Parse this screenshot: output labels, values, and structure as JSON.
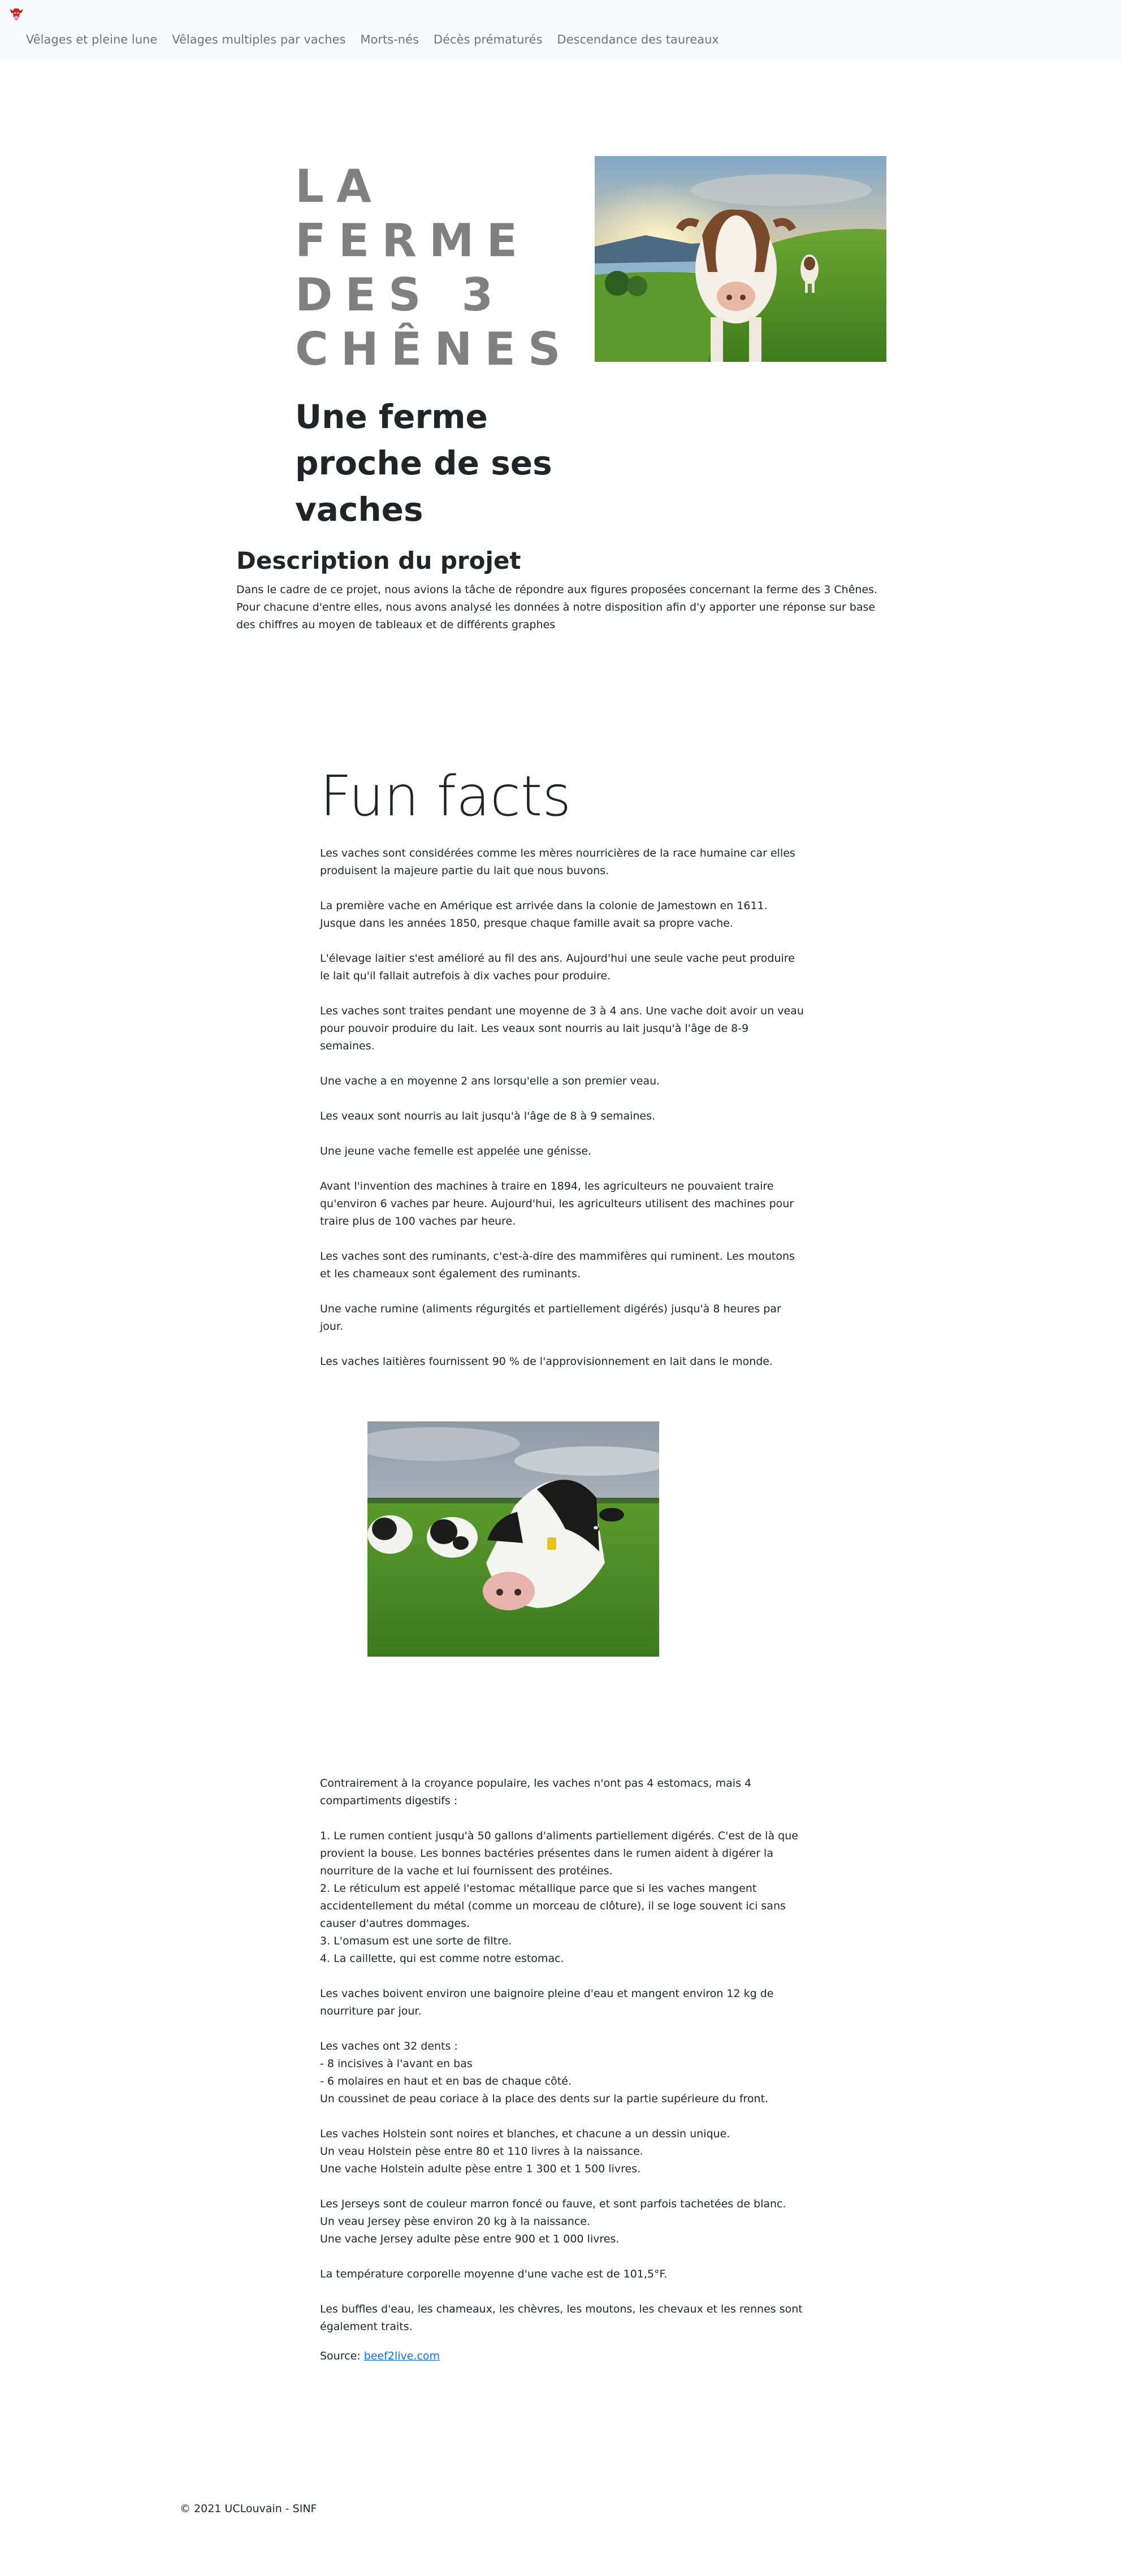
{
  "navbar": {
    "logo_icon": "cow-head-icon",
    "links": [
      "Vêlages et pleine lune",
      "Vêlages multiples par vaches",
      "Morts-nés",
      "Décès prématurés",
      "Descendance des taureaux"
    ]
  },
  "hero": {
    "title_lines": [
      "LA",
      "FERME",
      "DES 3",
      "CHÊNES"
    ],
    "subtitle": "Une ferme proche de ses vaches"
  },
  "description": {
    "title": "Description du projet",
    "text": "Dans le cadre de ce projet, nous avions la tâche de répondre aux figures proposées concernant la ferme des 3 Chênes. Pour chacune d'entre elles, nous avons analysé les données à notre disposition afin d'y apporter une réponse sur base des chiffres au moyen de tableaux et de différents graphes"
  },
  "fun_facts": {
    "title": "Fun facts",
    "facts": [
      "Les vaches sont considérées comme les mères nourricières de la race humaine car elles produisent la majeure partie du lait que nous buvons.",
      "La première vache en Amérique est arrivée dans la colonie de Jamestown en 1611. Jusque dans les années 1850, presque chaque famille avait sa propre vache.",
      "L'élevage laitier s'est amélioré au fil des ans. Aujourd'hui une seule vache peut produire le lait qu'il fallait autrefois à dix vaches pour produire.",
      "Les vaches sont traites pendant une moyenne de 3 à 4 ans. Une vache doit avoir un veau pour pouvoir produire du lait. Les veaux sont nourris au lait jusqu'à l'âge de 8-9 semaines.",
      "Une vache a en moyenne 2 ans lorsqu'elle a son premier veau.",
      "Les veaux sont nourris au lait jusqu'à l'âge de 8 à 9 semaines.",
      "Une jeune vache femelle est appelée une génisse.",
      "Avant l'invention des machines à traire en 1894, les agriculteurs ne pouvaient traire qu'environ 6 vaches par heure. Aujourd'hui, les agriculteurs utilisent des machines pour traire plus de 100 vaches par heure.",
      "Les vaches sont des ruminants, c'est-à-dire des mammifères qui ruminent. Les moutons et les chameaux sont également des ruminants.",
      "Une vache rumine (aliments régurgités et partiellement digérés) jusqu'à 8 heures par jour.",
      "Les vaches laitières fournissent 90 % de l'approvisionnement en lait dans le monde."
    ],
    "facts2": [
      [
        "Contrairement à la croyance populaire, les vaches n'ont pas 4 estomacs, mais 4 compartiments digestifs :"
      ],
      [
        "1. Le rumen contient jusqu'à 50 gallons d'aliments partiellement digérés. C'est de là que provient la bouse. Les bonnes bactéries présentes dans le rumen aident à digérer la nourriture de la vache et lui fournissent des protéines.",
        "2. Le réticulum est appelé l'estomac métallique parce que si les vaches mangent accidentellement du métal (comme un morceau de clôture), il se loge souvent ici sans causer d'autres dommages.",
        "3. L'omasum est une sorte de filtre.",
        "4. La caillette, qui est comme notre estomac."
      ],
      [
        "Les vaches boivent environ une baignoire pleine d'eau et mangent environ 12 kg de nourriture par jour."
      ],
      [
        "Les vaches ont 32 dents :",
        "- 8 incisives à l'avant en bas",
        "- 6 molaires en haut et en bas de chaque côté.",
        "Un coussinet de peau coriace à la place des dents sur la partie supérieure du front."
      ],
      [
        "Les vaches Holstein sont noires et blanches, et chacune a un dessin unique.",
        "Un veau Holstein pèse entre 80 et 110 livres à la naissance.",
        "Une vache Holstein adulte pèse entre 1 300 et 1 500 livres."
      ],
      [
        "Les Jerseys sont de couleur marron foncé ou fauve, et sont parfois tachetées de blanc.",
        "Un veau Jersey pèse environ 20 kg à la naissance.",
        "Une vache Jersey adulte pèse entre 900 et 1 000 livres."
      ],
      [
        "La température corporelle moyenne d'une vache est de 101,5°F."
      ],
      [
        "Les buffles d'eau, les chameaux, les chèvres, les moutons, les chevaux et les rennes sont également traits."
      ]
    ],
    "source_label": "Source: ",
    "source_link": "beef2live.com"
  },
  "footer": {
    "text": "© 2021 UCLouvain - SINF"
  },
  "colors": {
    "navbar_bg": "#f8f9fa",
    "nav_link": "#6c757d",
    "hero_title": "#808080",
    "link": "#0d6efd"
  }
}
